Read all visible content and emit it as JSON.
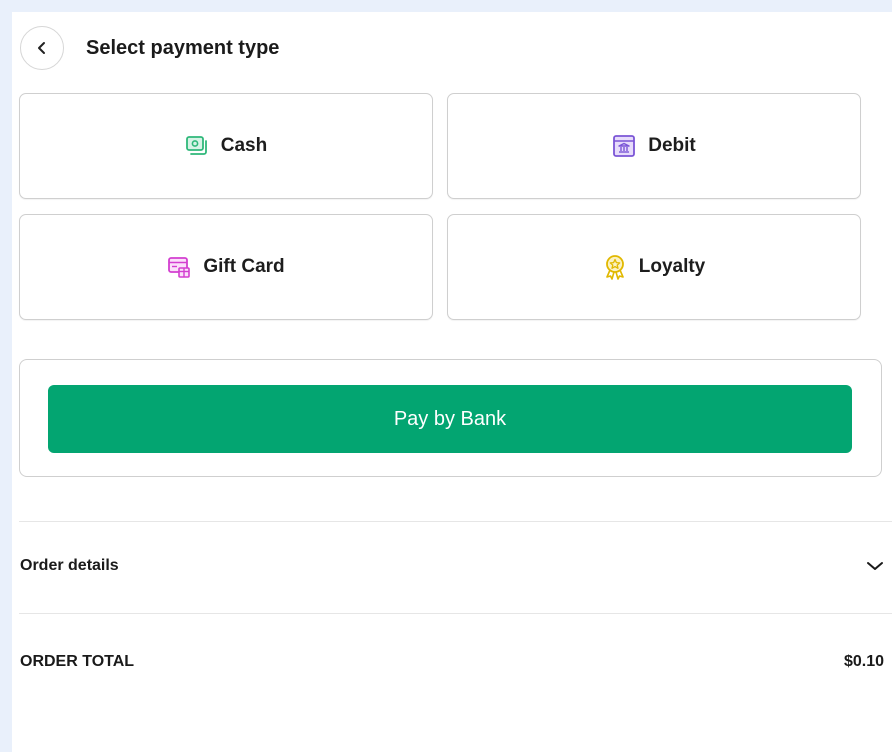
{
  "header": {
    "title": "Select payment type",
    "back_icon": "chevron-left-icon"
  },
  "payment_options": [
    {
      "label": "Cash",
      "icon": "cash-icon",
      "color": "#2fb87a"
    },
    {
      "label": "Debit",
      "icon": "bank-card-icon",
      "color": "#7b55d6"
    },
    {
      "label": "Gift Card",
      "icon": "gift-card-icon",
      "color": "#d33fd0"
    },
    {
      "label": "Loyalty",
      "icon": "award-badge-icon",
      "color": "#e1b800"
    }
  ],
  "pay_by_bank": {
    "label": "Pay by Bank",
    "color": "#03a571"
  },
  "order_details": {
    "label": "Order details",
    "toggle_icon": "chevron-down-icon"
  },
  "order_total": {
    "label": "ORDER TOTAL",
    "value": "$0.10"
  }
}
